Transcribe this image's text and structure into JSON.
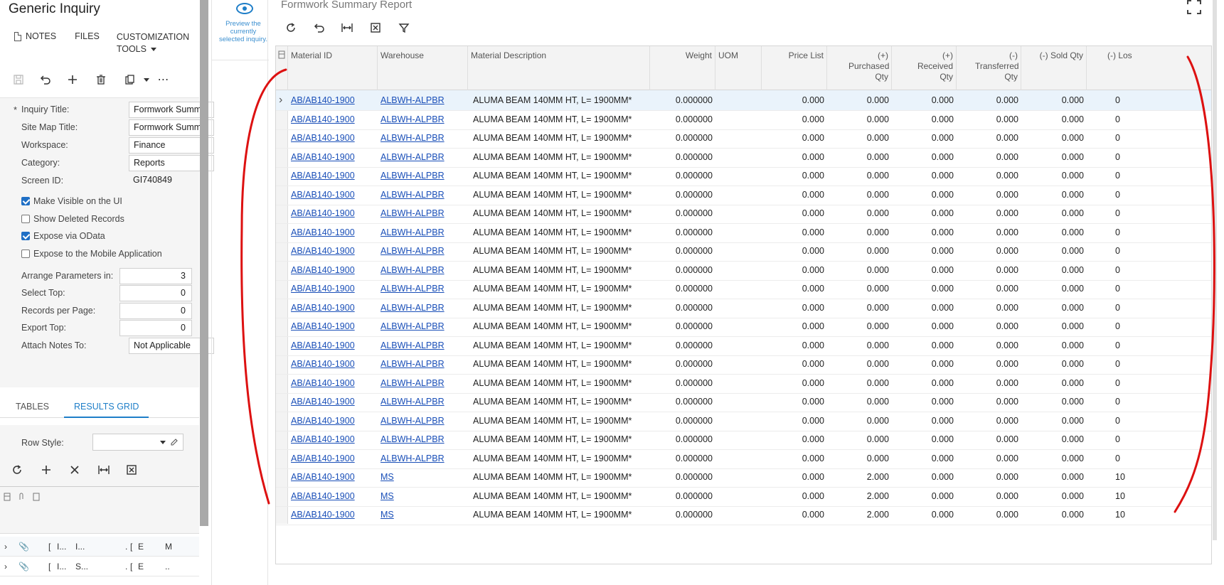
{
  "left": {
    "title": "Generic Inquiry",
    "links": {
      "notes": "NOTES",
      "files": "FILES",
      "customization_1": "CUSTOMIZATION",
      "customization_2": "TOOLS"
    },
    "form": {
      "inquiry_title_label": "Inquiry Title:",
      "inquiry_title_value": "Formwork Summ",
      "site_map_label": "Site Map Title:",
      "site_map_value": "Formwork Summ",
      "workspace_label": "Workspace:",
      "workspace_value": "Finance",
      "category_label": "Category:",
      "category_value": "Reports",
      "screen_id_label": "Screen ID:",
      "screen_id_value": "GI740849",
      "make_visible": "Make Visible on the UI",
      "show_deleted": "Show Deleted Records",
      "expose_odata": "Expose via OData",
      "expose_mobile": "Expose to the Mobile Application",
      "arrange_label": "Arrange Parameters in:",
      "arrange_value": "3",
      "select_top_label": "Select Top:",
      "select_top_value": "0",
      "records_label": "Records per Page:",
      "records_value": "0",
      "export_label": "Export Top:",
      "export_value": "0",
      "attach_label": "Attach Notes To:",
      "attach_value": "Not Applicable"
    },
    "tabs": {
      "tables": "TABLES",
      "results": "RESULTS GRID"
    },
    "row_style_label": "Row Style:",
    "mini_rows": [
      {
        "c1": "[",
        "c2": "I...",
        "c3": "I...",
        "c4": ".",
        "c5": "[",
        "c6": "E",
        "c7": "M"
      },
      {
        "c1": "[",
        "c2": "I...",
        "c3": "S...",
        "c4": ".",
        "c5": "[",
        "c6": "E",
        "c7": ".."
      }
    ]
  },
  "preview": {
    "text": "Preview the currently selected inquiry."
  },
  "main": {
    "title": "Formwork Summary Report",
    "columns": {
      "material_id": "Material ID",
      "warehouse": "Warehouse",
      "description": "Material Description",
      "weight": "Weight",
      "uom": "UOM",
      "price_list": "Price List",
      "purchased": "(+) Purchased Qty",
      "received": "(+) Received Qty",
      "transferred": "(-) Transferred Qty",
      "sold": "(-) Sold Qty",
      "lost": "(-) Los"
    }
  },
  "grid_rows": [
    {
      "id": "AB/AB140-1900",
      "wh": "ALBWH-ALPBR",
      "desc": "ALUMA BEAM 140MM HT, L= 1900MM*",
      "weight": "0.000000",
      "price": "0.000",
      "purch": "0.000",
      "recv": "0.000",
      "trans": "0.000",
      "sold": "0.000",
      "lost": "0"
    },
    {
      "id": "AB/AB140-1900",
      "wh": "ALBWH-ALPBR",
      "desc": "ALUMA BEAM 140MM HT, L= 1900MM*",
      "weight": "0.000000",
      "price": "0.000",
      "purch": "0.000",
      "recv": "0.000",
      "trans": "0.000",
      "sold": "0.000",
      "lost": "0"
    },
    {
      "id": "AB/AB140-1900",
      "wh": "ALBWH-ALPBR",
      "desc": "ALUMA BEAM 140MM HT, L= 1900MM*",
      "weight": "0.000000",
      "price": "0.000",
      "purch": "0.000",
      "recv": "0.000",
      "trans": "0.000",
      "sold": "0.000",
      "lost": "0"
    },
    {
      "id": "AB/AB140-1900",
      "wh": "ALBWH-ALPBR",
      "desc": "ALUMA BEAM 140MM HT, L= 1900MM*",
      "weight": "0.000000",
      "price": "0.000",
      "purch": "0.000",
      "recv": "0.000",
      "trans": "0.000",
      "sold": "0.000",
      "lost": "0"
    },
    {
      "id": "AB/AB140-1900",
      "wh": "ALBWH-ALPBR",
      "desc": "ALUMA BEAM 140MM HT, L= 1900MM*",
      "weight": "0.000000",
      "price": "0.000",
      "purch": "0.000",
      "recv": "0.000",
      "trans": "0.000",
      "sold": "0.000",
      "lost": "0"
    },
    {
      "id": "AB/AB140-1900",
      "wh": "ALBWH-ALPBR",
      "desc": "ALUMA BEAM 140MM HT, L= 1900MM*",
      "weight": "0.000000",
      "price": "0.000",
      "purch": "0.000",
      "recv": "0.000",
      "trans": "0.000",
      "sold": "0.000",
      "lost": "0"
    },
    {
      "id": "AB/AB140-1900",
      "wh": "ALBWH-ALPBR",
      "desc": "ALUMA BEAM 140MM HT, L= 1900MM*",
      "weight": "0.000000",
      "price": "0.000",
      "purch": "0.000",
      "recv": "0.000",
      "trans": "0.000",
      "sold": "0.000",
      "lost": "0"
    },
    {
      "id": "AB/AB140-1900",
      "wh": "ALBWH-ALPBR",
      "desc": "ALUMA BEAM 140MM HT, L= 1900MM*",
      "weight": "0.000000",
      "price": "0.000",
      "purch": "0.000",
      "recv": "0.000",
      "trans": "0.000",
      "sold": "0.000",
      "lost": "0"
    },
    {
      "id": "AB/AB140-1900",
      "wh": "ALBWH-ALPBR",
      "desc": "ALUMA BEAM 140MM HT, L= 1900MM*",
      "weight": "0.000000",
      "price": "0.000",
      "purch": "0.000",
      "recv": "0.000",
      "trans": "0.000",
      "sold": "0.000",
      "lost": "0"
    },
    {
      "id": "AB/AB140-1900",
      "wh": "ALBWH-ALPBR",
      "desc": "ALUMA BEAM 140MM HT, L= 1900MM*",
      "weight": "0.000000",
      "price": "0.000",
      "purch": "0.000",
      "recv": "0.000",
      "trans": "0.000",
      "sold": "0.000",
      "lost": "0"
    },
    {
      "id": "AB/AB140-1900",
      "wh": "ALBWH-ALPBR",
      "desc": "ALUMA BEAM 140MM HT, L= 1900MM*",
      "weight": "0.000000",
      "price": "0.000",
      "purch": "0.000",
      "recv": "0.000",
      "trans": "0.000",
      "sold": "0.000",
      "lost": "0"
    },
    {
      "id": "AB/AB140-1900",
      "wh": "ALBWH-ALPBR",
      "desc": "ALUMA BEAM 140MM HT, L= 1900MM*",
      "weight": "0.000000",
      "price": "0.000",
      "purch": "0.000",
      "recv": "0.000",
      "trans": "0.000",
      "sold": "0.000",
      "lost": "0"
    },
    {
      "id": "AB/AB140-1900",
      "wh": "ALBWH-ALPBR",
      "desc": "ALUMA BEAM 140MM HT, L= 1900MM*",
      "weight": "0.000000",
      "price": "0.000",
      "purch": "0.000",
      "recv": "0.000",
      "trans": "0.000",
      "sold": "0.000",
      "lost": "0"
    },
    {
      "id": "AB/AB140-1900",
      "wh": "ALBWH-ALPBR",
      "desc": "ALUMA BEAM 140MM HT, L= 1900MM*",
      "weight": "0.000000",
      "price": "0.000",
      "purch": "0.000",
      "recv": "0.000",
      "trans": "0.000",
      "sold": "0.000",
      "lost": "0"
    },
    {
      "id": "AB/AB140-1900",
      "wh": "ALBWH-ALPBR",
      "desc": "ALUMA BEAM 140MM HT, L= 1900MM*",
      "weight": "0.000000",
      "price": "0.000",
      "purch": "0.000",
      "recv": "0.000",
      "trans": "0.000",
      "sold": "0.000",
      "lost": "0"
    },
    {
      "id": "AB/AB140-1900",
      "wh": "ALBWH-ALPBR",
      "desc": "ALUMA BEAM 140MM HT, L= 1900MM*",
      "weight": "0.000000",
      "price": "0.000",
      "purch": "0.000",
      "recv": "0.000",
      "trans": "0.000",
      "sold": "0.000",
      "lost": "0"
    },
    {
      "id": "AB/AB140-1900",
      "wh": "ALBWH-ALPBR",
      "desc": "ALUMA BEAM 140MM HT, L= 1900MM*",
      "weight": "0.000000",
      "price": "0.000",
      "purch": "0.000",
      "recv": "0.000",
      "trans": "0.000",
      "sold": "0.000",
      "lost": "0"
    },
    {
      "id": "AB/AB140-1900",
      "wh": "ALBWH-ALPBR",
      "desc": "ALUMA BEAM 140MM HT, L= 1900MM*",
      "weight": "0.000000",
      "price": "0.000",
      "purch": "0.000",
      "recv": "0.000",
      "trans": "0.000",
      "sold": "0.000",
      "lost": "0"
    },
    {
      "id": "AB/AB140-1900",
      "wh": "ALBWH-ALPBR",
      "desc": "ALUMA BEAM 140MM HT, L= 1900MM*",
      "weight": "0.000000",
      "price": "0.000",
      "purch": "0.000",
      "recv": "0.000",
      "trans": "0.000",
      "sold": "0.000",
      "lost": "0"
    },
    {
      "id": "AB/AB140-1900",
      "wh": "ALBWH-ALPBR",
      "desc": "ALUMA BEAM 140MM HT, L= 1900MM*",
      "weight": "0.000000",
      "price": "0.000",
      "purch": "0.000",
      "recv": "0.000",
      "trans": "0.000",
      "sold": "0.000",
      "lost": "0"
    },
    {
      "id": "AB/AB140-1900",
      "wh": "MS",
      "desc": "ALUMA BEAM 140MM HT, L= 1900MM*",
      "weight": "0.000000",
      "price": "0.000",
      "purch": "2.000",
      "recv": "0.000",
      "trans": "0.000",
      "sold": "0.000",
      "lost": "10"
    },
    {
      "id": "AB/AB140-1900",
      "wh": "MS",
      "desc": "ALUMA BEAM 140MM HT, L= 1900MM*",
      "weight": "0.000000",
      "price": "0.000",
      "purch": "2.000",
      "recv": "0.000",
      "trans": "0.000",
      "sold": "0.000",
      "lost": "10"
    },
    {
      "id": "AB/AB140-1900",
      "wh": "MS",
      "desc": "ALUMA BEAM 140MM HT, L= 1900MM*",
      "weight": "0.000000",
      "price": "0.000",
      "purch": "2.000",
      "recv": "0.000",
      "trans": "0.000",
      "sold": "0.000",
      "lost": "10"
    }
  ],
  "colors": {
    "accent": "#1e7ec8",
    "link": "#1a4fb8",
    "annotation": "#dd1111"
  }
}
